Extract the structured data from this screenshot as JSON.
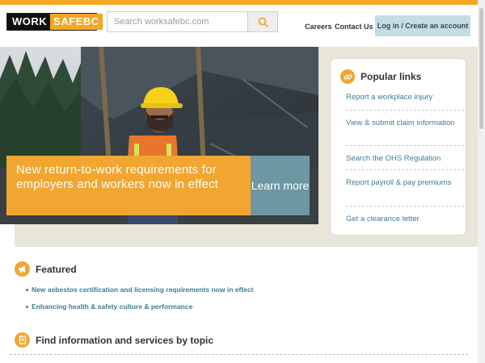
{
  "header": {
    "logo_word1": "WORK",
    "logo_word2": "SAFEBC",
    "search_placeholder": "Search worksafebc.com",
    "nav": [
      "Careers",
      "Contact Us"
    ],
    "login_label": "Log in / Create an account"
  },
  "hero": {
    "headline": "New return-to-work requirements for employers and workers now in effect",
    "learn_more": "Learn more"
  },
  "popular": {
    "title": "Popular links",
    "links": [
      "Report a workplace injury",
      "View & submit claim information",
      "Search the OHS Regulation",
      "Report payroll & pay premiums",
      "Get a clearance letter"
    ]
  },
  "featured": {
    "title": "Featured",
    "items": [
      "New asbestos certification and licensing requirements now in effect",
      "Enhancing health & safety culture & performance"
    ]
  },
  "topics": {
    "title": "Find information and services by topic"
  },
  "colors": {
    "accent": "#f1a632",
    "link": "#3c7c95",
    "learn_more_bg": "#6d97a3"
  }
}
